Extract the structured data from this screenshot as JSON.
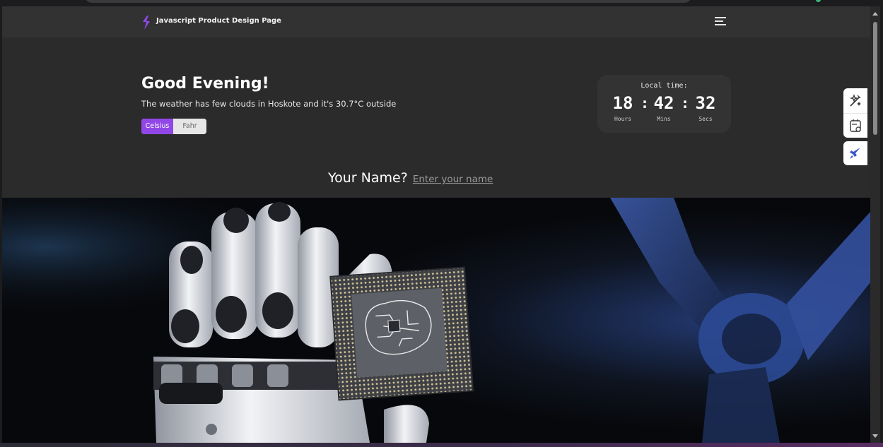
{
  "navbar": {
    "brand": "Javascript Product Design Page",
    "logo_color": "#9147e8"
  },
  "hero": {
    "greeting": "Good Evening!",
    "weather_text": "The weather has few clouds in Hoskote and it's 30.7°C outside",
    "units": {
      "celsius_label": "Celsius",
      "fahr_label": "Fahr",
      "selected": "Celsius"
    },
    "clock": {
      "title": "Local time:",
      "hours": "18",
      "mins": "42",
      "secs": "32",
      "hours_label": "Hours",
      "mins_label": "Mins",
      "secs_label": "Secs"
    },
    "name_prompt": {
      "label": "Your Name?",
      "placeholder": "Enter your name"
    }
  },
  "side_tools": {
    "items": [
      "magic-wand-icon",
      "settings-panel-icon",
      "rocket-icon"
    ]
  },
  "colors": {
    "accent": "#9147e8",
    "background": "#2b2b2b",
    "navbar": "#323232"
  }
}
